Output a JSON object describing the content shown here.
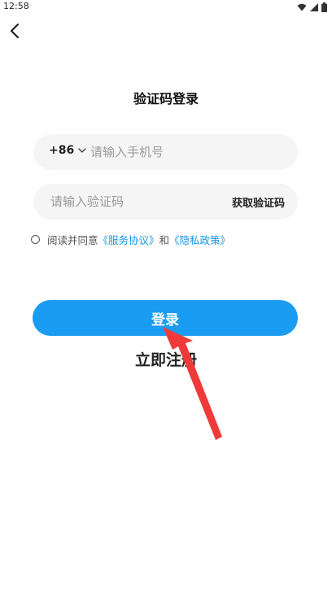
{
  "status_bar": {
    "time": "12:58",
    "icons": [
      "wifi-icon",
      "signal-icon",
      "battery-icon"
    ]
  },
  "header": {
    "back_icon": "chevron-left-icon",
    "title": "验证码登录"
  },
  "form": {
    "country_code": "+86",
    "phone_placeholder": "请输入手机号",
    "code_placeholder": "请输入验证码",
    "get_code_label": "获取验证码"
  },
  "agreement": {
    "prefix": "阅读并同意",
    "terms_link": "《服务协议》",
    "conjunction": "和",
    "privacy_link": "《隐私政策》"
  },
  "actions": {
    "login_label": "登录",
    "register_label": "立即注册"
  },
  "colors": {
    "accent": "#1a9cf2",
    "link": "#1796e6",
    "field_bg": "#f5f5f5",
    "annotation_arrow": "#f03a3a"
  }
}
